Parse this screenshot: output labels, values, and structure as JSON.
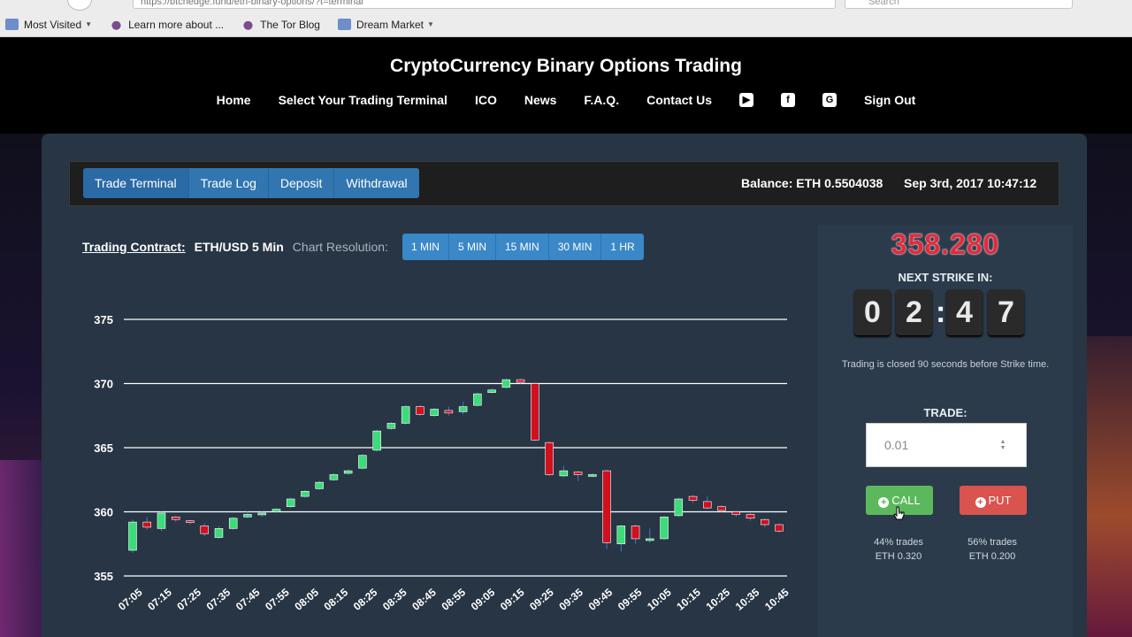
{
  "browser": {
    "url": "https://btchedge.fund/eth-binary-options/?t=terminal",
    "search_placeholder": "Search",
    "bookmarks": [
      {
        "label": "Most Visited",
        "icon": "folder-icon",
        "dropdown": true
      },
      {
        "label": "Learn more about ...",
        "icon": "onion-icon",
        "dropdown": false
      },
      {
        "label": "The Tor Blog",
        "icon": "onion-icon",
        "dropdown": false
      },
      {
        "label": "Dream Market",
        "icon": "folder-icon",
        "dropdown": true
      }
    ]
  },
  "site": {
    "title": "CryptoCurrency Binary Options Trading",
    "nav": [
      "Home",
      "Select Your Trading Terminal",
      "ICO",
      "News",
      "F.A.Q.",
      "Contact Us"
    ],
    "social_icons": [
      "youtube-icon",
      "facebook-icon",
      "google-plus-icon"
    ],
    "sign_out": "Sign Out"
  },
  "terminal": {
    "tabs": [
      "Trade Terminal",
      "Trade Log",
      "Deposit",
      "Withdrawal"
    ],
    "active_tab": "Trade Terminal",
    "balance": "Balance: ETH 0.5504038",
    "datetime": "Sep 3rd, 2017 10:47:12",
    "contract_label": "Trading Contract:",
    "contract_value": "ETH/USD 5 Min",
    "resolution_label": "Chart Resolution:",
    "resolutions": [
      "1 MIN",
      "5 MIN",
      "15 MIN",
      "30 MIN",
      "1 HR"
    ],
    "active_resolution": "5 MIN"
  },
  "side": {
    "price": "358.280",
    "next_strike_label": "NEXT STRIKE IN:",
    "countdown": [
      "0",
      "2",
      "4",
      "7"
    ],
    "closed_note": "Trading is closed 90 seconds before Strike time.",
    "trade_label": "TRADE:",
    "trade_value": "0.01",
    "call_label": "CALL",
    "put_label": "PUT",
    "call_pct": "44% trades",
    "call_amt": "ETH 0.320",
    "put_pct": "56% trades",
    "put_amt": "ETH 0.200",
    "colors": {
      "price": "#e5293a",
      "call": "#5cb85c",
      "put": "#d9534f"
    }
  },
  "chart_data": {
    "type": "candlestick",
    "ylim": [
      355,
      376
    ],
    "yticks": [
      375,
      370,
      365,
      360,
      355
    ],
    "xticks": [
      "07:05",
      "07:15",
      "07:25",
      "07:35",
      "07:45",
      "07:55",
      "08:05",
      "08:15",
      "08:25",
      "08:35",
      "08:45",
      "08:55",
      "09:05",
      "09:15",
      "09:25",
      "09:35",
      "09:45",
      "09:55",
      "10:05",
      "10:15",
      "10:25",
      "10:35",
      "10:45"
    ],
    "colors": {
      "up": "#3ddc7a",
      "down": "#d0101e",
      "grid": "#ffffff"
    },
    "candles": [
      {
        "o": 357.0,
        "c": 359.2,
        "h": 359.4,
        "l": 356.8
      },
      {
        "o": 359.2,
        "c": 358.8,
        "h": 359.6,
        "l": 358.6
      },
      {
        "o": 358.7,
        "c": 359.9,
        "h": 360.0,
        "l": 358.5
      },
      {
        "o": 359.6,
        "c": 359.4,
        "h": 359.7,
        "l": 359.2
      },
      {
        "o": 359.3,
        "c": 359.2,
        "h": 359.4,
        "l": 359.0
      },
      {
        "o": 358.9,
        "c": 358.3,
        "h": 359.1,
        "l": 358.1
      },
      {
        "o": 358.0,
        "c": 358.7,
        "h": 358.9,
        "l": 357.9
      },
      {
        "o": 358.7,
        "c": 359.5,
        "h": 359.6,
        "l": 358.6
      },
      {
        "o": 359.6,
        "c": 359.8,
        "h": 360.0,
        "l": 359.5
      },
      {
        "o": 359.8,
        "c": 359.9,
        "h": 360.0,
        "l": 359.6
      },
      {
        "o": 360.0,
        "c": 360.2,
        "h": 360.3,
        "l": 359.9
      },
      {
        "o": 360.4,
        "c": 361.0,
        "h": 361.1,
        "l": 360.3
      },
      {
        "o": 361.2,
        "c": 361.6,
        "h": 361.7,
        "l": 361.1
      },
      {
        "o": 361.8,
        "c": 362.3,
        "h": 362.4,
        "l": 361.7
      },
      {
        "o": 362.5,
        "c": 362.9,
        "h": 363.0,
        "l": 362.4
      },
      {
        "o": 363.0,
        "c": 363.2,
        "h": 363.3,
        "l": 362.9
      },
      {
        "o": 363.4,
        "c": 364.4,
        "h": 364.5,
        "l": 363.3
      },
      {
        "o": 364.8,
        "c": 366.3,
        "h": 366.4,
        "l": 364.7
      },
      {
        "o": 366.5,
        "c": 366.9,
        "h": 367.0,
        "l": 366.4
      },
      {
        "o": 366.9,
        "c": 368.2,
        "h": 368.3,
        "l": 366.8
      },
      {
        "o": 368.2,
        "c": 367.6,
        "h": 368.3,
        "l": 367.5
      },
      {
        "o": 367.5,
        "c": 368.0,
        "h": 368.1,
        "l": 367.4
      },
      {
        "o": 367.9,
        "c": 367.7,
        "h": 368.2,
        "l": 367.5
      },
      {
        "o": 367.8,
        "c": 368.2,
        "h": 368.6,
        "l": 367.6
      },
      {
        "o": 368.3,
        "c": 369.2,
        "h": 369.3,
        "l": 368.2
      },
      {
        "o": 369.3,
        "c": 369.5,
        "h": 369.6,
        "l": 369.2
      },
      {
        "o": 369.7,
        "c": 370.3,
        "h": 370.4,
        "l": 369.6
      },
      {
        "o": 370.3,
        "c": 370.1,
        "h": 370.4,
        "l": 370.0
      },
      {
        "o": 370.0,
        "c": 365.6,
        "h": 370.1,
        "l": 365.5
      },
      {
        "o": 365.4,
        "c": 362.9,
        "h": 365.5,
        "l": 362.8
      },
      {
        "o": 362.8,
        "c": 363.2,
        "h": 363.6,
        "l": 362.7
      },
      {
        "o": 363.1,
        "c": 362.9,
        "h": 363.2,
        "l": 362.4
      },
      {
        "o": 362.8,
        "c": 362.9,
        "h": 363.0,
        "l": 362.7
      },
      {
        "o": 363.2,
        "c": 357.6,
        "h": 363.3,
        "l": 357.1
      },
      {
        "o": 357.5,
        "c": 358.9,
        "h": 359.0,
        "l": 356.9
      },
      {
        "o": 358.9,
        "c": 357.9,
        "h": 359.0,
        "l": 357.5
      },
      {
        "o": 357.8,
        "c": 357.9,
        "h": 358.7,
        "l": 357.6
      },
      {
        "o": 357.9,
        "c": 359.6,
        "h": 359.7,
        "l": 357.8
      },
      {
        "o": 359.7,
        "c": 361.0,
        "h": 361.1,
        "l": 359.6
      },
      {
        "o": 361.2,
        "c": 360.9,
        "h": 361.3,
        "l": 360.7
      },
      {
        "o": 360.8,
        "c": 360.3,
        "h": 361.2,
        "l": 360.2
      },
      {
        "o": 360.4,
        "c": 360.1,
        "h": 360.5,
        "l": 360.0
      },
      {
        "o": 360.0,
        "c": 359.8,
        "h": 360.1,
        "l": 359.6
      },
      {
        "o": 359.8,
        "c": 359.5,
        "h": 359.9,
        "l": 359.3
      },
      {
        "o": 359.4,
        "c": 359.0,
        "h": 359.5,
        "l": 358.8
      },
      {
        "o": 359.0,
        "c": 358.5,
        "h": 359.1,
        "l": 358.4
      }
    ]
  }
}
